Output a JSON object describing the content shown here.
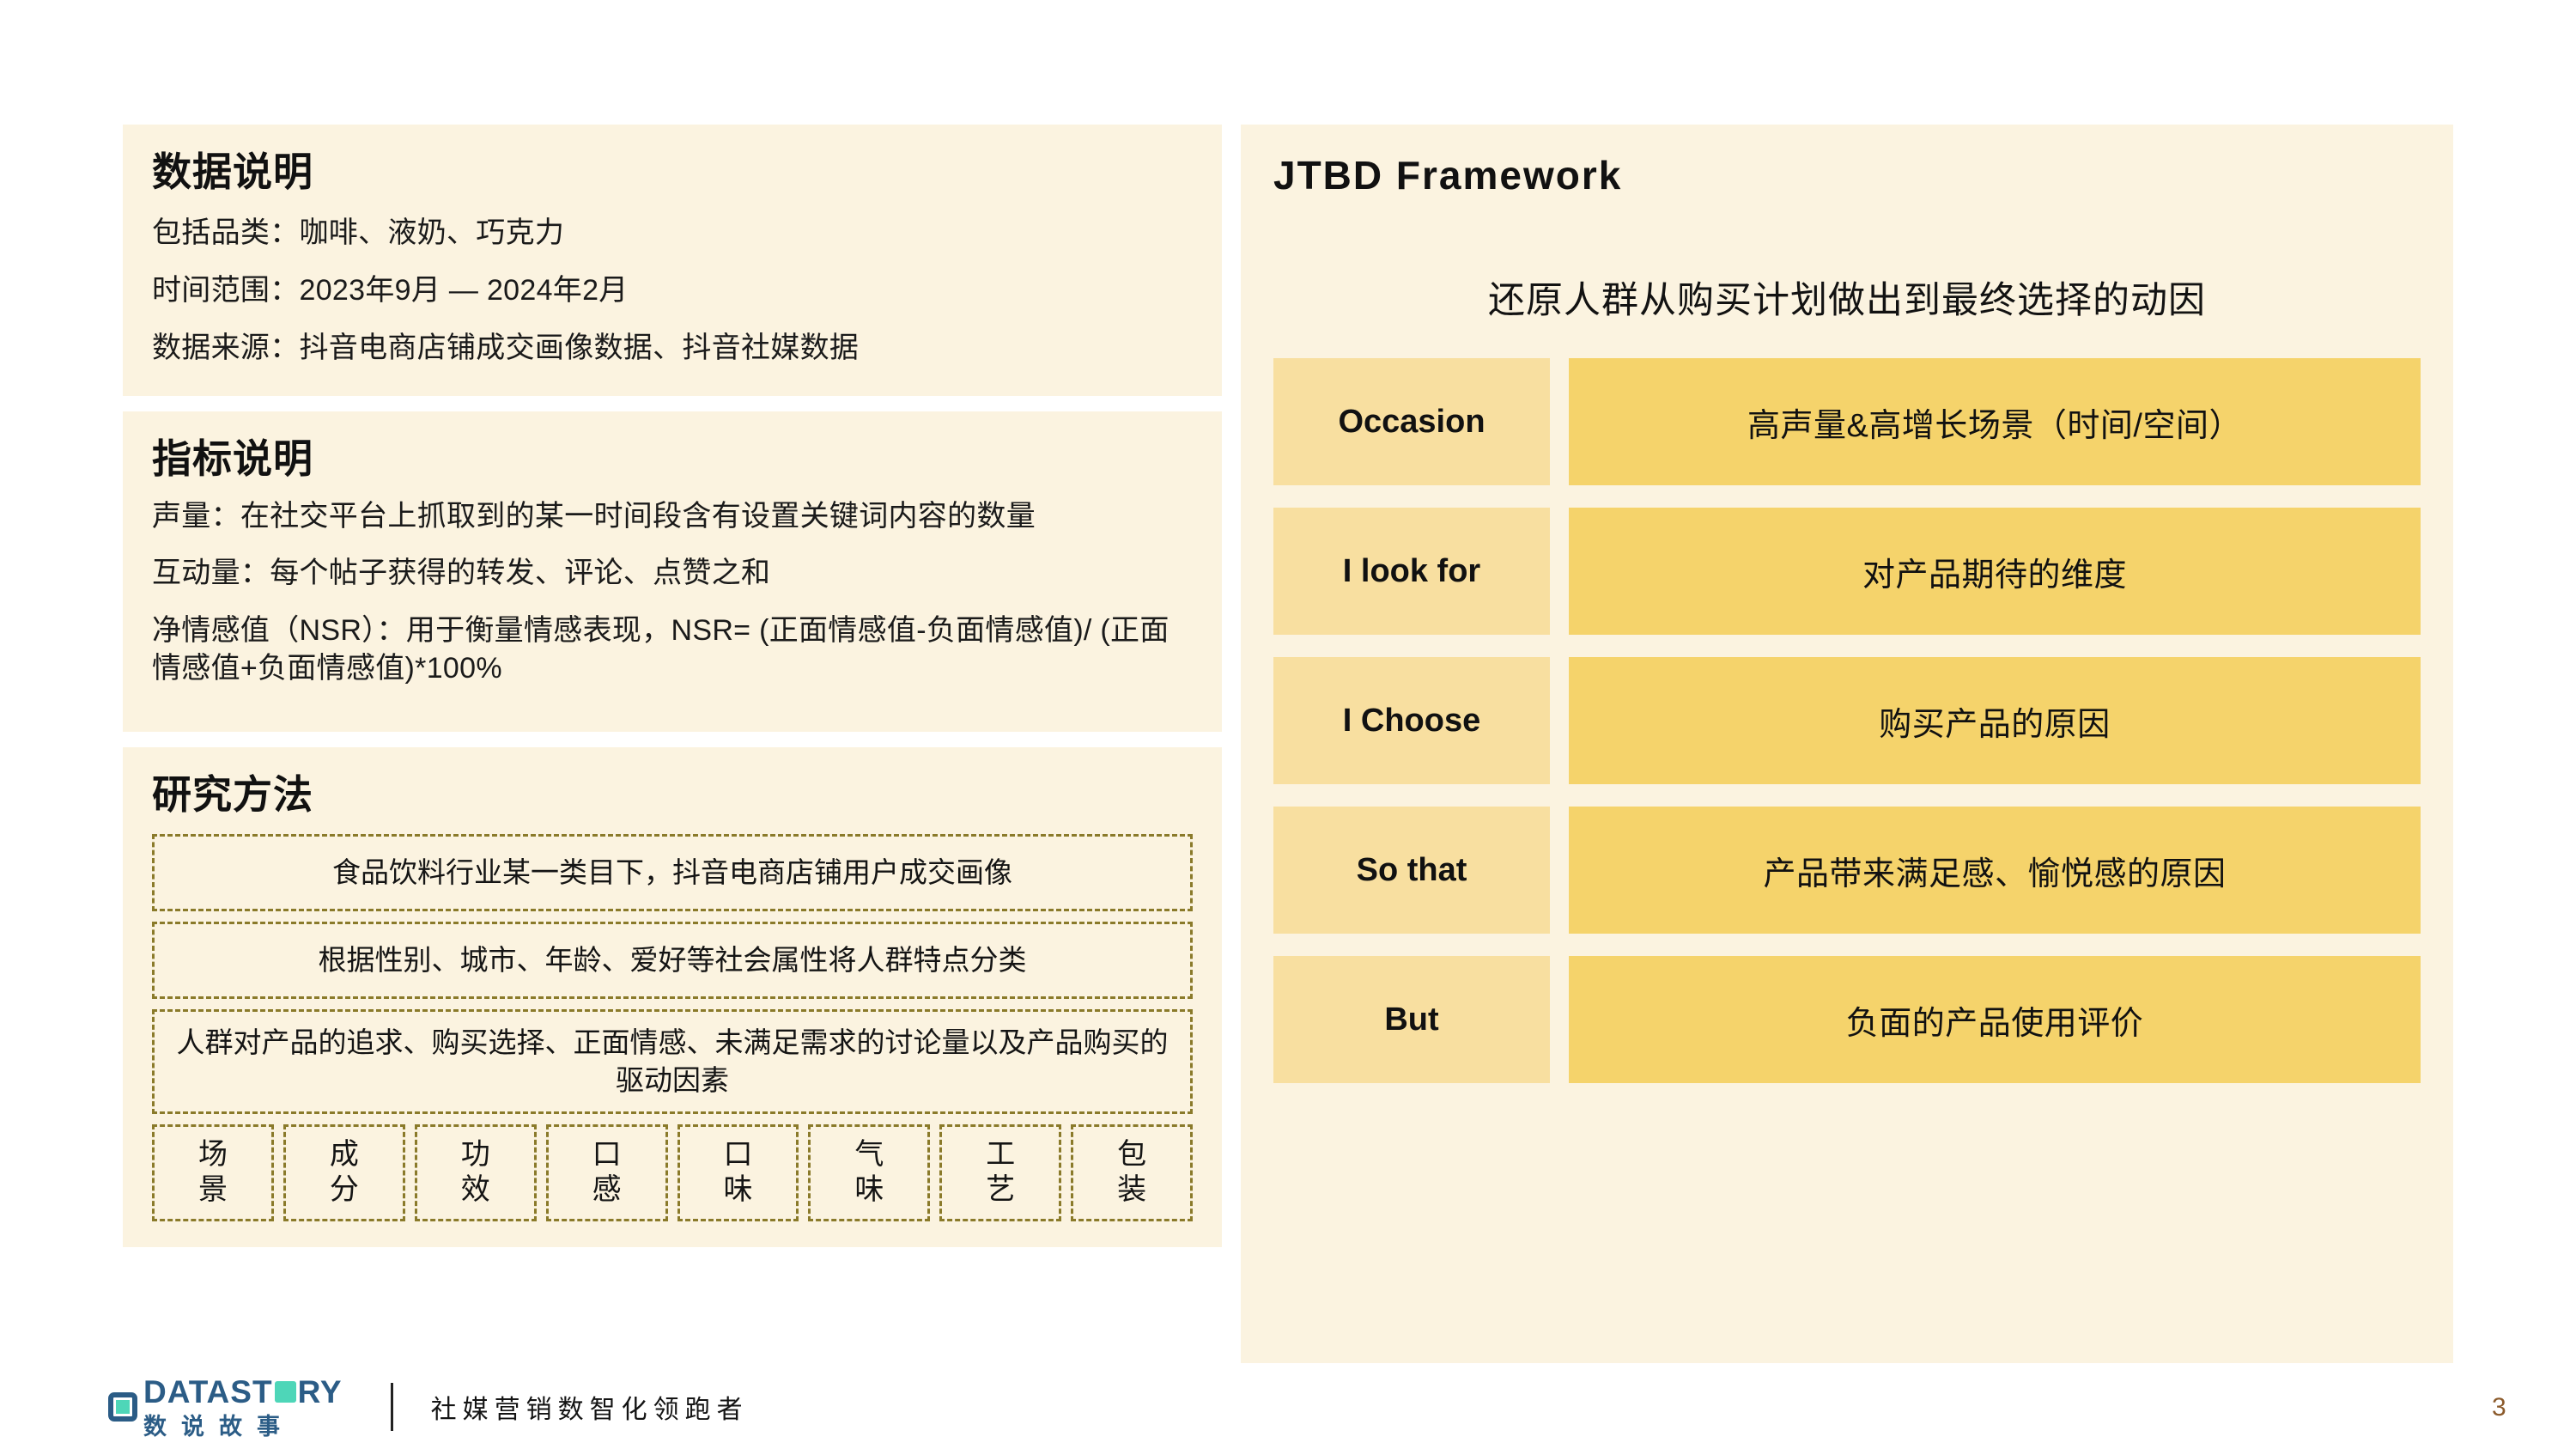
{
  "left_panel": {
    "data_description": {
      "title": "数据说明",
      "lines": [
        "包括品类：咖啡、液奶、巧克力",
        "时间范围：2023年9月 — 2024年2月",
        "数据来源：抖音电商店铺成交画像数据、抖音社媒数据"
      ]
    },
    "metric_description": {
      "title": "指标说明",
      "lines": [
        "声量：在社交平台上抓取到的某一时间段含有设置关键词内容的数量",
        "互动量：每个帖子获得的转发、评论、点赞之和",
        "净情感值（NSR）：用于衡量情感表现，NSR= (正面情感值-负面情感值)/ (正面情感值+负面情感值)*100%"
      ]
    },
    "research_method": {
      "title": "研究方法",
      "steps": [
        "食品饮料行业某一类目下，抖音电商店铺用户成交画像",
        "根据性别、城市、年龄、爱好等社会属性将人群特点分类",
        "人群对产品的追求、购买选择、正面情感、未满足需求的讨论量以及产品购买的驱动因素"
      ],
      "tags": [
        {
          "top": "场",
          "bottom": "景"
        },
        {
          "top": "成",
          "bottom": "分"
        },
        {
          "top": "功",
          "bottom": "效"
        },
        {
          "top": "口",
          "bottom": "感"
        },
        {
          "top": "口",
          "bottom": "味"
        },
        {
          "top": "气",
          "bottom": "味"
        },
        {
          "top": "工",
          "bottom": "艺"
        },
        {
          "top": "包",
          "bottom": "装"
        }
      ]
    }
  },
  "right_panel": {
    "title": "JTBD  Framework",
    "subtitle": "还原人群从购买计划做出到最终选择的动因",
    "rows": [
      {
        "key": "Occasion",
        "value": "高声量&高增长场景（时间/空间）"
      },
      {
        "key": "I look for",
        "value": "对产品期待的维度"
      },
      {
        "key": "I Choose",
        "value": "购买产品的原因"
      },
      {
        "key": "So that",
        "value": "产品带来满足感、愉悦感的原因"
      },
      {
        "key": "But",
        "value": "负面的产品使用评价"
      }
    ]
  },
  "footer": {
    "logo_en_part1": "DATAST",
    "logo_en_part2": "RY",
    "logo_cn": "数说故事",
    "tagline": "社媒营销数智化领跑者",
    "page_number": "3"
  },
  "colors": {
    "panel_background": "#FBF3E0",
    "jtbd_key_background": "#F8DFA0",
    "jtbd_value_background": "#F5D36B",
    "dashed_border": "#8A7A2A",
    "brand_blue": "#2B5C86",
    "brand_teal": "#4ED6B8",
    "page_number_color": "#8B5A2B"
  }
}
